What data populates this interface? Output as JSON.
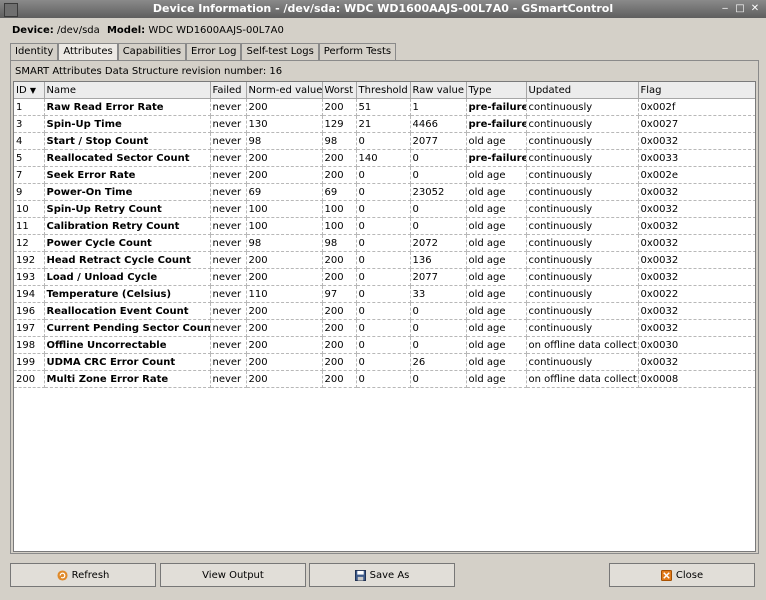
{
  "window": {
    "title": "Device Information - /dev/sda: WDC WD1600AAJS-00L7A0 - GSmartControl"
  },
  "device_line": {
    "device_label": "Device:",
    "device_value": "/dev/sda",
    "model_label": "Model:",
    "model_value": "WDC WD1600AAJS-00L7A0"
  },
  "tabs": [
    {
      "label": "Identity",
      "active": false
    },
    {
      "label": "Attributes",
      "active": true
    },
    {
      "label": "Capabilities",
      "active": false
    },
    {
      "label": "Error Log",
      "active": false
    },
    {
      "label": "Self-test Logs",
      "active": false
    },
    {
      "label": "Perform Tests",
      "active": false
    }
  ],
  "revision_text": "SMART Attributes Data Structure revision number: 16",
  "table": {
    "headers": [
      "ID",
      "Name",
      "Failed",
      "Norm-ed value",
      "Worst",
      "Threshold",
      "Raw value",
      "Type",
      "Updated",
      "Flag"
    ],
    "sort_indicator": "▼",
    "rows": [
      [
        "1",
        "Raw Read Error Rate",
        "never",
        "200",
        "200",
        "51",
        "1",
        "pre-failure",
        "continuously",
        "0x002f"
      ],
      [
        "3",
        "Spin-Up Time",
        "never",
        "130",
        "129",
        "21",
        "4466",
        "pre-failure",
        "continuously",
        "0x0027"
      ],
      [
        "4",
        "Start / Stop Count",
        "never",
        "98",
        "98",
        "0",
        "2077",
        "old age",
        "continuously",
        "0x0032"
      ],
      [
        "5",
        "Reallocated Sector Count",
        "never",
        "200",
        "200",
        "140",
        "0",
        "pre-failure",
        "continuously",
        "0x0033"
      ],
      [
        "7",
        "Seek Error Rate",
        "never",
        "200",
        "200",
        "0",
        "0",
        "old age",
        "continuously",
        "0x002e"
      ],
      [
        "9",
        "Power-On Time",
        "never",
        "69",
        "69",
        "0",
        "23052",
        "old age",
        "continuously",
        "0x0032"
      ],
      [
        "10",
        "Spin-Up Retry Count",
        "never",
        "100",
        "100",
        "0",
        "0",
        "old age",
        "continuously",
        "0x0032"
      ],
      [
        "11",
        "Calibration Retry Count",
        "never",
        "100",
        "100",
        "0",
        "0",
        "old age",
        "continuously",
        "0x0032"
      ],
      [
        "12",
        "Power Cycle Count",
        "never",
        "98",
        "98",
        "0",
        "2072",
        "old age",
        "continuously",
        "0x0032"
      ],
      [
        "192",
        "Head Retract Cycle Count",
        "never",
        "200",
        "200",
        "0",
        "136",
        "old age",
        "continuously",
        "0x0032"
      ],
      [
        "193",
        "Load / Unload Cycle",
        "never",
        "200",
        "200",
        "0",
        "2077",
        "old age",
        "continuously",
        "0x0032"
      ],
      [
        "194",
        "Temperature (Celsius)",
        "never",
        "110",
        "97",
        "0",
        "33",
        "old age",
        "continuously",
        "0x0022"
      ],
      [
        "196",
        "Reallocation Event Count",
        "never",
        "200",
        "200",
        "0",
        "0",
        "old age",
        "continuously",
        "0x0032"
      ],
      [
        "197",
        "Current Pending Sector Count",
        "never",
        "200",
        "200",
        "0",
        "0",
        "old age",
        "continuously",
        "0x0032"
      ],
      [
        "198",
        "Offline Uncorrectable",
        "never",
        "200",
        "200",
        "0",
        "0",
        "old age",
        "on offline data collect.",
        "0x0030"
      ],
      [
        "199",
        "UDMA CRC Error Count",
        "never",
        "200",
        "200",
        "0",
        "26",
        "old age",
        "continuously",
        "0x0032"
      ],
      [
        "200",
        "Multi Zone Error Rate",
        "never",
        "200",
        "200",
        "0",
        "0",
        "old age",
        "on offline data collect.",
        "0x0008"
      ]
    ]
  },
  "buttons": {
    "refresh": "Refresh",
    "view_output": "View Output",
    "save_as": "Save As",
    "close": "Close"
  },
  "icons": {
    "refresh": "refresh-icon",
    "save": "save-icon",
    "close": "close-icon"
  },
  "colors": {
    "titlebar": "#6e6e6e",
    "window_bg": "#d4d0c8",
    "refresh_icon": "#e08a2a",
    "close_icon": "#e07a1a"
  }
}
